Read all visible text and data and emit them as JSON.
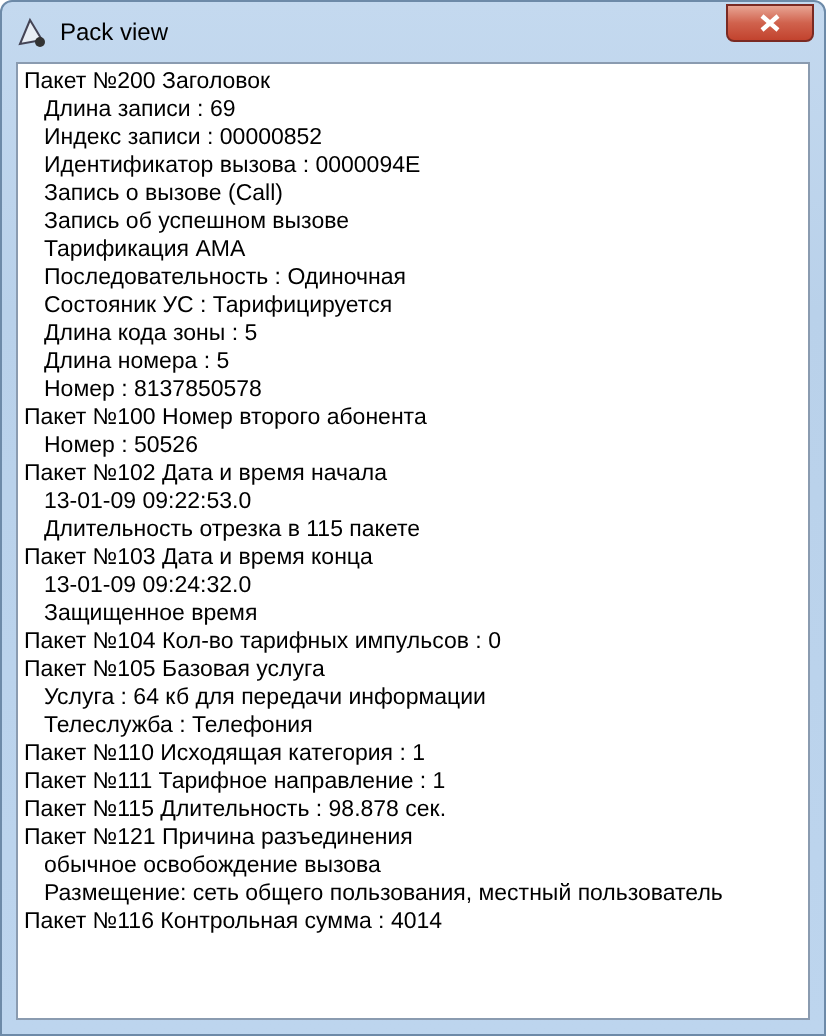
{
  "window": {
    "title": "Pack view"
  },
  "packets": [
    {
      "title": "Пакет №200 Заголовок",
      "lines": [
        "Длина записи : 69",
        "Индекс записи : 00000852",
        "Идентификатор вызова : 0000094E",
        "Запись о вызове (Call)",
        "Запись об успешном вызове",
        "Тарификация AMA",
        "Последовательность : Одиночная",
        "Состояник УС : Тарифицируется",
        "Длина кода зоны : 5",
        "Длина номера : 5",
        "Номер : 8137850578"
      ]
    },
    {
      "title": "Пакет №100 Номер второго абонента",
      "lines": [
        "Номер : 50526"
      ]
    },
    {
      "title": "Пакет №102 Дата и время начала",
      "lines": [
        "13-01-09 09:22:53.0",
        "Длительность отрезка в 115 пакете"
      ]
    },
    {
      "title": "Пакет №103 Дата и время конца",
      "lines": [
        "13-01-09 09:24:32.0",
        "Защищенное время"
      ]
    },
    {
      "title": "Пакет №104 Кол-во тарифных импульсов : 0"
    },
    {
      "title": "Пакет №105 Базовая услуга",
      "lines": [
        "Услуга : 64 кб для передачи информации",
        "Телеслужба : Телефония"
      ]
    },
    {
      "title": "Пакет №110 Исходящая категория : 1"
    },
    {
      "title": "Пакет №111 Тарифное направление : 1"
    },
    {
      "title": "Пакет №115 Длительность : 98.878 сек."
    },
    {
      "title": "Пакет №121 Причина разъединения",
      "lines": [
        "обычное освобождение вызова",
        "Размещение: сеть общего пользования, местный пользователь"
      ]
    },
    {
      "title": "Пакет №116 Контрольная сумма : 4014"
    }
  ]
}
